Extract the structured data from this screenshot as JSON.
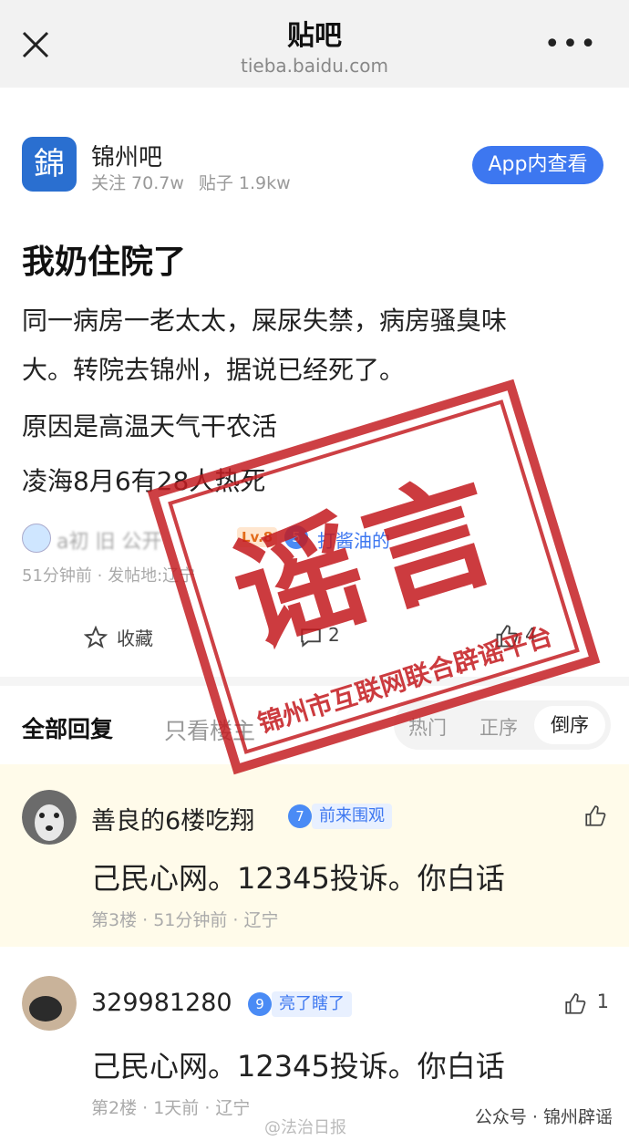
{
  "topbar": {
    "title": "贴吧",
    "url": "tieba.baidu.com",
    "more": "•••"
  },
  "forum": {
    "logo_char": "錦",
    "name": "锦州吧",
    "followers": "关注 70.7w",
    "posts": "贴子 1.9kw",
    "app_button": "App内查看"
  },
  "post": {
    "title": "我奶住院了",
    "body": [
      "同一病房一老太太，屎尿失禁，病房骚臭味",
      "大。转院去锦州，据说已经死了。",
      "原因是高温天气干农活",
      "凌海8月6有28人热死"
    ],
    "author": {
      "name": "a初 旧 公开",
      "level": "Lv.8",
      "badge_num": "5",
      "badge_text": "打酱油的"
    },
    "meta": "51分钟前 · 发帖地:辽宁",
    "actions": {
      "collect": "收藏",
      "comments": "2",
      "likes": "4"
    }
  },
  "reply_tabs": {
    "all": "全部回复",
    "owner_only": "只看楼主",
    "sort": [
      "热门",
      "正序",
      "倒序"
    ]
  },
  "replies": [
    {
      "name": "善良的6楼吃翔",
      "badge_num": "7",
      "badge_text": "前来围观",
      "text": "己民心网。12345投诉。你白话",
      "meta": "第3楼 · 51分钟前 · 辽宁",
      "likes": ""
    },
    {
      "name": "329981280",
      "badge_num": "9",
      "badge_text": "亮了瞎了",
      "text": "己民心网。12345投诉。你白话",
      "meta": "第2楼 · 1天前 · 辽宁",
      "likes": "1"
    }
  ],
  "stamp": {
    "main": "谣言",
    "sub": "锦州市互联网联合辟谣平台"
  },
  "watermarks": {
    "left": "@法治日报",
    "right": "公众号 · 锦州辟谣"
  },
  "colors": {
    "accent": "#3d77f0",
    "stamp": "#c41b20",
    "highlight": "#fffbea"
  }
}
